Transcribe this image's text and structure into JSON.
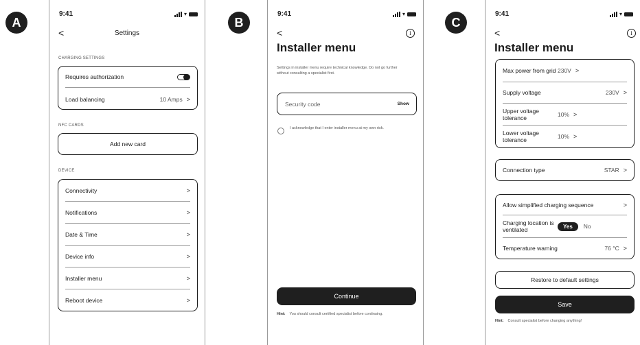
{
  "panel_a": {
    "badge": "A",
    "time": "9:41",
    "back": "<",
    "title": "Settings",
    "charging_label": "CHARGING SETTINGS",
    "requires_auth": "Requires authorization",
    "load_balancing": "Load balancing",
    "load_balancing_value": "10 Amps",
    "nfc_label": "NFC CARDS",
    "add_card": "Add new card",
    "device_label": "DEVICE",
    "device_items": [
      "Connectivity",
      "Notifications",
      "Date & Time",
      "Device info",
      "Installer menu",
      "Reboot device"
    ]
  },
  "panel_b": {
    "badge": "B",
    "time": "9:41",
    "back": "<",
    "title": "Installer menu",
    "warning": "Settings in installer menu require technical knowledge. Do not go further without consulting a specialist first.",
    "security_placeholder": "Security code",
    "show": "Show",
    "acknowledge": "I acknowledge that I enter installer menu at my own risk.",
    "continue": "Continue",
    "hint_label": "Hint:",
    "hint_text": "You should consult certified specialist before continuing."
  },
  "panel_c": {
    "badge": "C",
    "time": "9:41",
    "back": "<",
    "title": "Installer menu",
    "group1": [
      {
        "label": "Max power from grid",
        "value": "230V"
      },
      {
        "label": "Supply voltage",
        "value": "230V"
      },
      {
        "label": "Upper voltage tolerance",
        "value": "10%"
      },
      {
        "label": "Lower voltage tolerance",
        "value": "10%"
      }
    ],
    "connection_type": "Connection type",
    "connection_value": "STAR",
    "simplified": "Allow simplified charging sequence",
    "ventilated": "Charging location is ventilated",
    "yes": "Yes",
    "no": "No",
    "temp_warning": "Temperature warning",
    "temp_value": "76 °C",
    "restore": "Restore to default settings",
    "save": "Save",
    "hint_label": "Hint:",
    "hint_text": "Consult specialist before changing anything!"
  },
  "chevron": ">",
  "info": "i"
}
